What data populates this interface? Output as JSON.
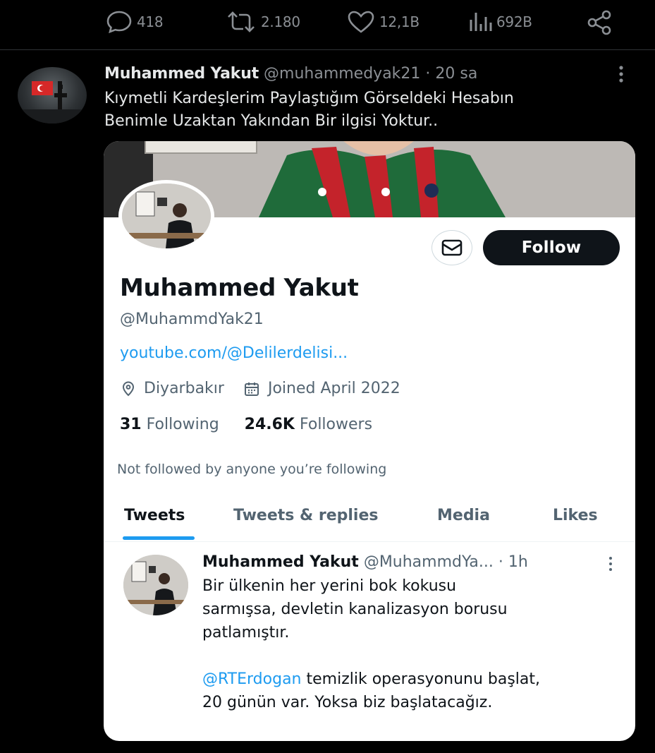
{
  "actions": {
    "replies": "418",
    "retweets": "2.180",
    "likes": "12,1B",
    "views": "692B"
  },
  "outer_tweet": {
    "name": "Muhammed Yakut",
    "handle": "@muhammedyak21",
    "time": "· 20 sa",
    "text_line1": "Kıymetli Kardeşlerim Paylaştığım Görseldeki Hesabın",
    "text_line2": "Benimle Uzaktan Yakından Bir ilgisi Yoktur.."
  },
  "profile": {
    "name": "Muhammed Yakut",
    "handle": "@MuhammdYak21",
    "link": "youtube.com/@Delilerdelisi...",
    "location": "Diyarbakır",
    "joined": "Joined April 2022",
    "following_count": "31",
    "following_label": "Following",
    "followers_count": "24.6K",
    "followers_label": "Followers",
    "not_followed": "Not followed by anyone you’re following",
    "follow_label": "Follow"
  },
  "tabs": [
    "Tweets",
    "Tweets & replies",
    "Media",
    "Likes"
  ],
  "inner_tweet": {
    "name": "Muhammed Yakut",
    "handle": "@MuhammdYa...",
    "time": "· 1h",
    "line1": "Bir ülkenin her yerini bok kokusu",
    "line2": "sarmışsa, devletin kanalizasyon borusu",
    "line3": "patlamıştır.",
    "mention": "@RTErdogan",
    "line4_rest": " temizlik operasyonunu başlat,",
    "line5": "20 günün var. Yoksa biz başlatacağız."
  },
  "colors": {
    "background": "#000000",
    "card": "#ffffff",
    "link": "#1d9bf0",
    "follow_button": "#0f1419"
  }
}
